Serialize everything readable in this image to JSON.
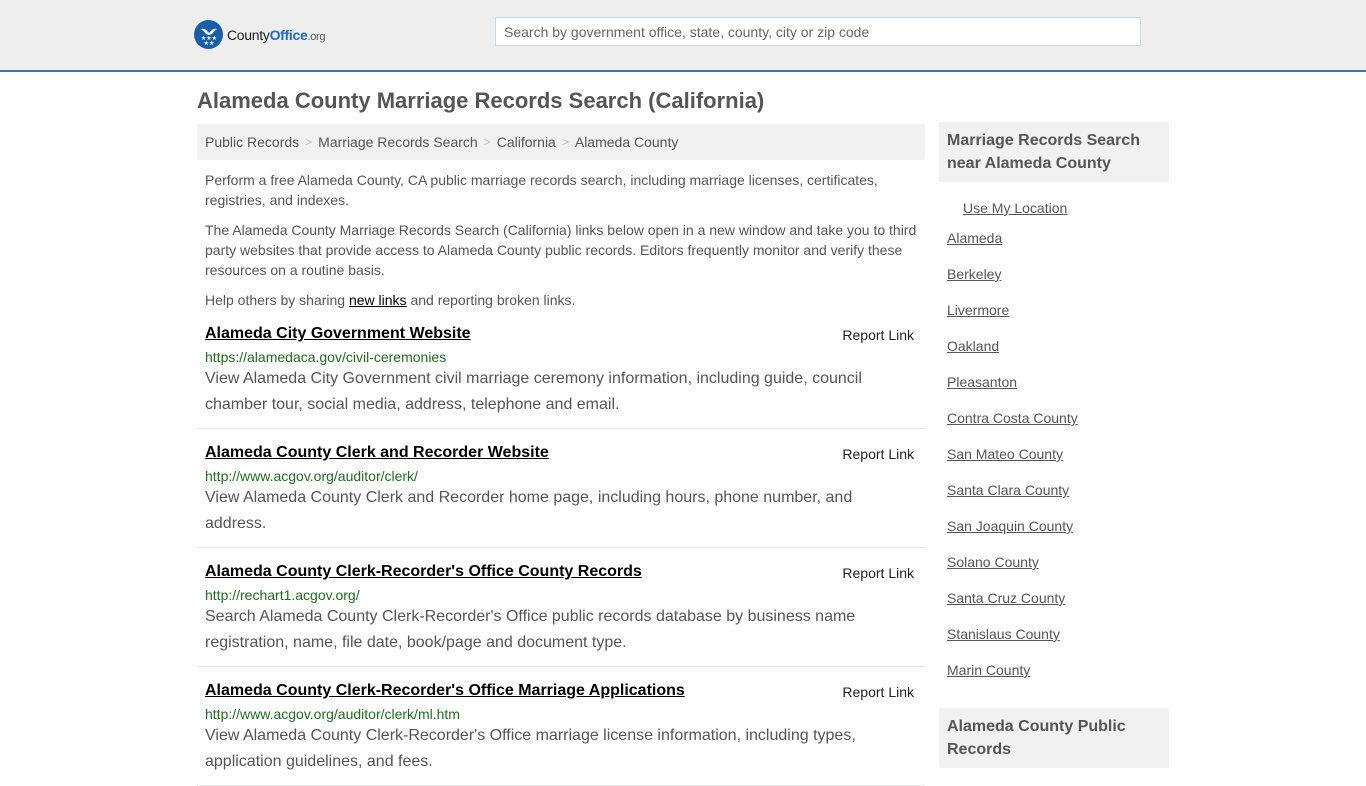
{
  "header": {
    "logo": {
      "name_part1": "County",
      "name_part2": "Office",
      "name_suffix": ".org"
    },
    "search": {
      "placeholder": "Search by government office, state, county, city or zip code",
      "value": ""
    }
  },
  "page": {
    "title": "Alameda County Marriage Records Search (California)"
  },
  "breadcrumb": [
    {
      "label": "Public Records"
    },
    {
      "label": "Marriage Records Search"
    },
    {
      "label": "California"
    },
    {
      "label": "Alameda County"
    }
  ],
  "intro": {
    "p1": "Perform a free Alameda County, CA public marriage records search, including marriage licenses, certificates, registries, and indexes.",
    "p2": "The Alameda County Marriage Records Search (California) links below open in a new window and take you to third party websites that provide access to Alameda County public records. Editors frequently monitor and verify these resources on a routine basis.",
    "p3_before": "Help others by sharing ",
    "p3_link": "new links",
    "p3_after": " and reporting broken links."
  },
  "listings": [
    {
      "title": "Alameda City Government Website",
      "url": "https://alamedaca.gov/civil-ceremonies",
      "description": "View Alameda City Government civil marriage ceremony information, including guide, council chamber tour, social media, address, telephone and email.",
      "report_label": "Report Link"
    },
    {
      "title": "Alameda County Clerk and Recorder Website",
      "url": "http://www.acgov.org/auditor/clerk/",
      "description": "View Alameda County Clerk and Recorder home page, including hours, phone number, and address.",
      "report_label": "Report Link"
    },
    {
      "title": "Alameda County Clerk-Recorder's Office County Records",
      "url": "http://rechart1.acgov.org/",
      "description": "Search Alameda County Clerk-Recorder's Office public records database by business name registration, name, file date, book/page and document type.",
      "report_label": "Report Link"
    },
    {
      "title": "Alameda County Clerk-Recorder's Office Marriage Applications",
      "url": "http://www.acgov.org/auditor/clerk/ml.htm",
      "description": "View Alameda County Clerk-Recorder's Office marriage license information, including types, application guidelines, and fees.",
      "report_label": "Report Link"
    }
  ],
  "sidebar": {
    "nearby_heading": "Marriage Records Search near Alameda County",
    "use_location": "Use My Location",
    "nearby": [
      "Alameda",
      "Berkeley",
      "Livermore",
      "Oakland",
      "Pleasanton",
      "Contra Costa County",
      "San Mateo County",
      "Santa Clara County",
      "San Joaquin County",
      "Solano County",
      "Santa Cruz County",
      "Stanislaus County",
      "Marin County"
    ],
    "public_records_heading": "Alameda County Public Records"
  },
  "colors": {
    "accent": "#3379b5",
    "url_green": "#236b23",
    "logo_blue": "#1a5ea8"
  }
}
